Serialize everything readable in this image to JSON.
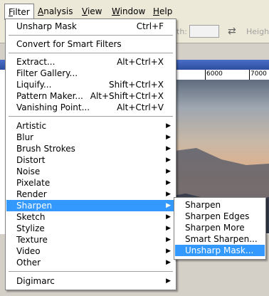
{
  "menubar": {
    "items": [
      "Filter",
      "Analysis",
      "View",
      "Window",
      "Help"
    ],
    "underline": [
      "F",
      "A",
      "V",
      "W",
      "H"
    ]
  },
  "options_bar": {
    "width_label": "th:",
    "height_label": "Heigh"
  },
  "ruler": {
    "mark1": "6000",
    "mark2": "7000"
  },
  "filter_menu": {
    "unsharp_mask": {
      "label": "Unsharp Mask",
      "shortcut": "Ctrl+F"
    },
    "convert": "Convert for Smart Filters",
    "extract": {
      "label": "Extract...",
      "shortcut": "Alt+Ctrl+X"
    },
    "filter_gallery": "Filter Gallery...",
    "liquify": {
      "label": "Liquify...",
      "shortcut": "Shift+Ctrl+X"
    },
    "pattern_maker": {
      "label": "Pattern Maker...",
      "shortcut": "Alt+Shift+Ctrl+X"
    },
    "vanishing_point": {
      "label": "Vanishing Point...",
      "shortcut": "Alt+Ctrl+V"
    },
    "submenus": [
      "Artistic",
      "Blur",
      "Brush Strokes",
      "Distort",
      "Noise",
      "Pixelate",
      "Render",
      "Sharpen",
      "Sketch",
      "Stylize",
      "Texture",
      "Video",
      "Other"
    ],
    "digimarc": "Digimarc",
    "highlighted": "Sharpen"
  },
  "sharpen_submenu": {
    "items": [
      "Sharpen",
      "Sharpen Edges",
      "Sharpen More",
      "Smart Sharpen...",
      "Unsharp Mask..."
    ],
    "highlighted": "Unsharp Mask..."
  },
  "colors": {
    "highlight": "#3399ff",
    "menubar": "#ece9d8"
  },
  "icons": {
    "submenu_arrow": "▶",
    "swap": "⇄"
  }
}
